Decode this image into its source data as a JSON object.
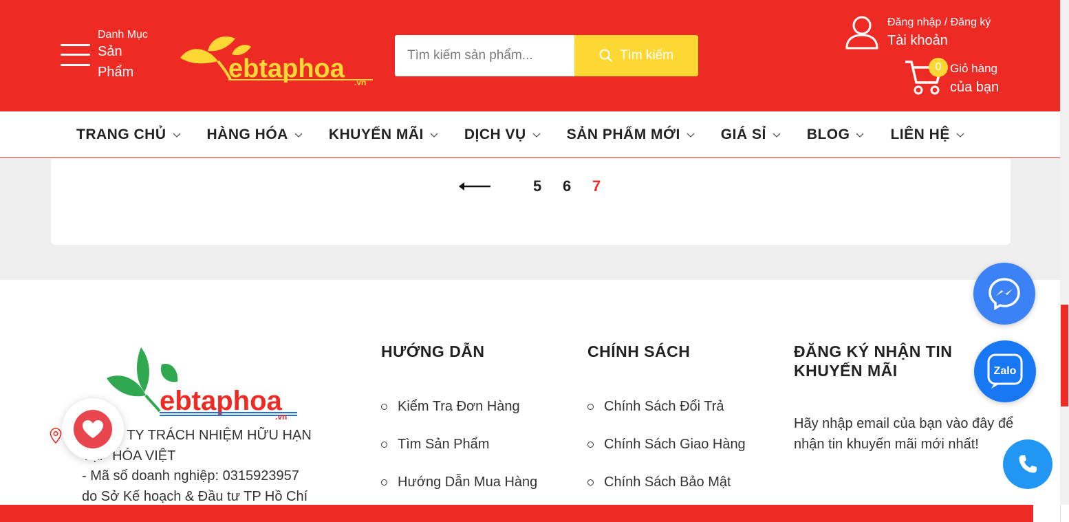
{
  "header": {
    "category_small": "Danh Mục",
    "category_big_1": "Sản",
    "category_big_2": "Phẩm",
    "logo_text": "ebtaphoa",
    "logo_suffix": ".vn",
    "search_placeholder": "Tìm kiếm sản phẩm...",
    "search_button": "Tìm kiếm",
    "account_small": "Đăng nhập / Đăng ký",
    "account_big": "Tài khoản",
    "cart_count": "0",
    "cart_small": "Giỏ hàng",
    "cart_big": "của bạn"
  },
  "nav": {
    "items": [
      "TRANG CHỦ",
      "HÀNG HÓA",
      "KHUYẾN MÃI",
      "DỊCH VỤ",
      "SẢN PHẨM MỚI",
      "GIÁ SỈ",
      "BLOG",
      "LIÊN HỆ"
    ]
  },
  "pagination": {
    "pages": [
      "5",
      "6",
      "7"
    ],
    "current": "7"
  },
  "footer": {
    "company_line1": "CÔNG TY TRÁCH NHIỆM HỮU HẠN",
    "company_line2": "TẠP HÓA VIỆT",
    "company_line3": "- Mã số doanh nghiệp: 0315923957",
    "company_line4": "do Sở Kế hoạch & Đầu tư TP Hồ Chí",
    "guide_title": "HƯỚNG DẪN",
    "guide_items": [
      "Kiểm Tra Đơn Hàng",
      "Tìm Sản Phẩm",
      "Hướng Dẫn Mua Hàng"
    ],
    "policy_title": "CHÍNH SÁCH",
    "policy_items": [
      "Chính Sách Đổi Trả",
      "Chính Sách Giao Hàng",
      "Chính Sách Bảo Mật"
    ],
    "subscribe_title_1": "ĐĂNG KÝ NHẬN TIN",
    "subscribe_title_2": "KHUYẾN MÃI",
    "subscribe_text": "Hãy nhập email của bạn vào đây để nhận tin khuyến mãi mới nhất!"
  },
  "floating": {
    "zalo_label": "Zalo"
  },
  "colors": {
    "brand_red": "#ee2a25",
    "accent_yellow": "#fdd835",
    "messenger_blue": "#3b82f6",
    "zalo_blue": "#1877f2",
    "phone_blue": "#2196f3"
  }
}
